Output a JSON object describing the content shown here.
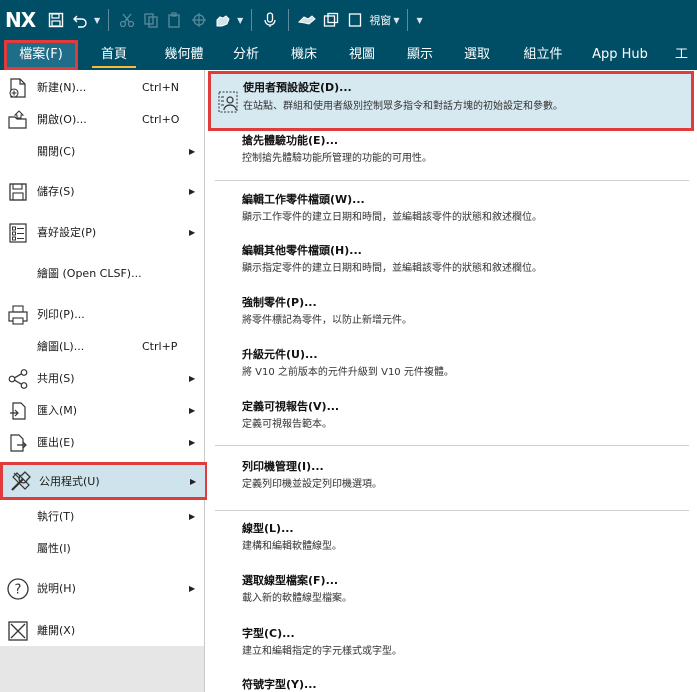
{
  "app": {
    "logo": "NX",
    "window_label": "視窗"
  },
  "quick_access": {
    "icons": [
      "save-icon",
      "undo-icon",
      "cut-icon",
      "copy-icon",
      "paste-icon",
      "command-finder-icon",
      "microphone-icon",
      "touch-mode-icon",
      "window-icon"
    ]
  },
  "ribbon_tabs": [
    {
      "label": "檔案(F)"
    },
    {
      "label": "首頁"
    },
    {
      "label": "幾何體"
    },
    {
      "label": "分析"
    },
    {
      "label": "機床"
    },
    {
      "label": "視圖"
    },
    {
      "label": "顯示"
    },
    {
      "label": "選取"
    },
    {
      "label": "組立件"
    },
    {
      "label": "App Hub"
    },
    {
      "label": "工"
    }
  ],
  "file_menu": [
    {
      "label": "新建(N)...",
      "shortcut": "Ctrl+N",
      "arrow": "",
      "icon": "new-file-icon"
    },
    {
      "label": "開啟(O)...",
      "shortcut": "Ctrl+O",
      "arrow": "",
      "icon": "open-folder-icon"
    },
    {
      "label": "關閉(C)",
      "shortcut": "",
      "arrow": "▶",
      "icon": ""
    },
    {
      "label": "儲存(S)",
      "shortcut": "",
      "arrow": "▶",
      "icon": "save-icon"
    },
    {
      "label": "喜好設定(P)",
      "shortcut": "",
      "arrow": "▶",
      "icon": "preferences-icon"
    },
    {
      "label": "繪圖 (Open CLSF)...",
      "shortcut": "",
      "arrow": "",
      "icon": ""
    },
    {
      "label": "列印(P)...",
      "shortcut": "",
      "arrow": "",
      "icon": "print-icon"
    },
    {
      "label": "繪圖(L)...",
      "shortcut": "Ctrl+P",
      "arrow": "",
      "icon": ""
    },
    {
      "label": "共用(S)",
      "shortcut": "",
      "arrow": "▶",
      "icon": "share-icon"
    },
    {
      "label": "匯入(M)",
      "shortcut": "",
      "arrow": "▶",
      "icon": "import-icon"
    },
    {
      "label": "匯出(E)",
      "shortcut": "",
      "arrow": "▶",
      "icon": "export-icon"
    },
    {
      "label": "公用程式(U)",
      "shortcut": "",
      "arrow": "▶",
      "icon": "utilities-icon"
    },
    {
      "label": "執行(T)",
      "shortcut": "",
      "arrow": "▶",
      "icon": ""
    },
    {
      "label": "屬性(I)",
      "shortcut": "",
      "arrow": "",
      "icon": ""
    },
    {
      "label": "說明(H)",
      "shortcut": "",
      "arrow": "▶",
      "icon": "help-icon"
    },
    {
      "label": "離開(X)",
      "shortcut": "",
      "arrow": "",
      "icon": "exit-icon"
    }
  ],
  "submenu": [
    {
      "title": "使用者預設設定(D)...",
      "desc": "在站點、群組和使用者級別控制眾多指令和對話方塊的初始設定和參數。"
    },
    {
      "title": "搶先體驗功能(E)...",
      "desc": "控制搶先體驗功能所管理的功能的可用性。"
    },
    {
      "title": "編輯工作零件檔頭(W)...",
      "desc": "顯示工作零件的建立日期和時間，並編輯該零件的狀態和敘述欄位。"
    },
    {
      "title": "編輯其他零件檔頭(H)...",
      "desc": "顯示指定零件的建立日期和時間，並編輯該零件的狀態和敘述欄位。"
    },
    {
      "title": "強制零件(P)...",
      "desc": "將零件標記為零件，以防止新增元件。"
    },
    {
      "title": "升級元件(U)...",
      "desc": "將 V10 之前版本的元件升級到 V10 元件複體。"
    },
    {
      "title": "定義可視報告(V)...",
      "desc": "定義可視報告範本。"
    },
    {
      "title": "列印機管理(I)...",
      "desc": "定義列印機並設定列印機選項。"
    },
    {
      "title": "線型(L)...",
      "desc": "建構和編輯軟體線型。"
    },
    {
      "title": "選取線型檔案(F)...",
      "desc": "載入新的軟體線型檔案。"
    },
    {
      "title": "字型(C)...",
      "desc": "建立和編輯指定的字元樣式或字型。"
    },
    {
      "title": "符號字型(Y)...",
      "desc": ""
    }
  ]
}
